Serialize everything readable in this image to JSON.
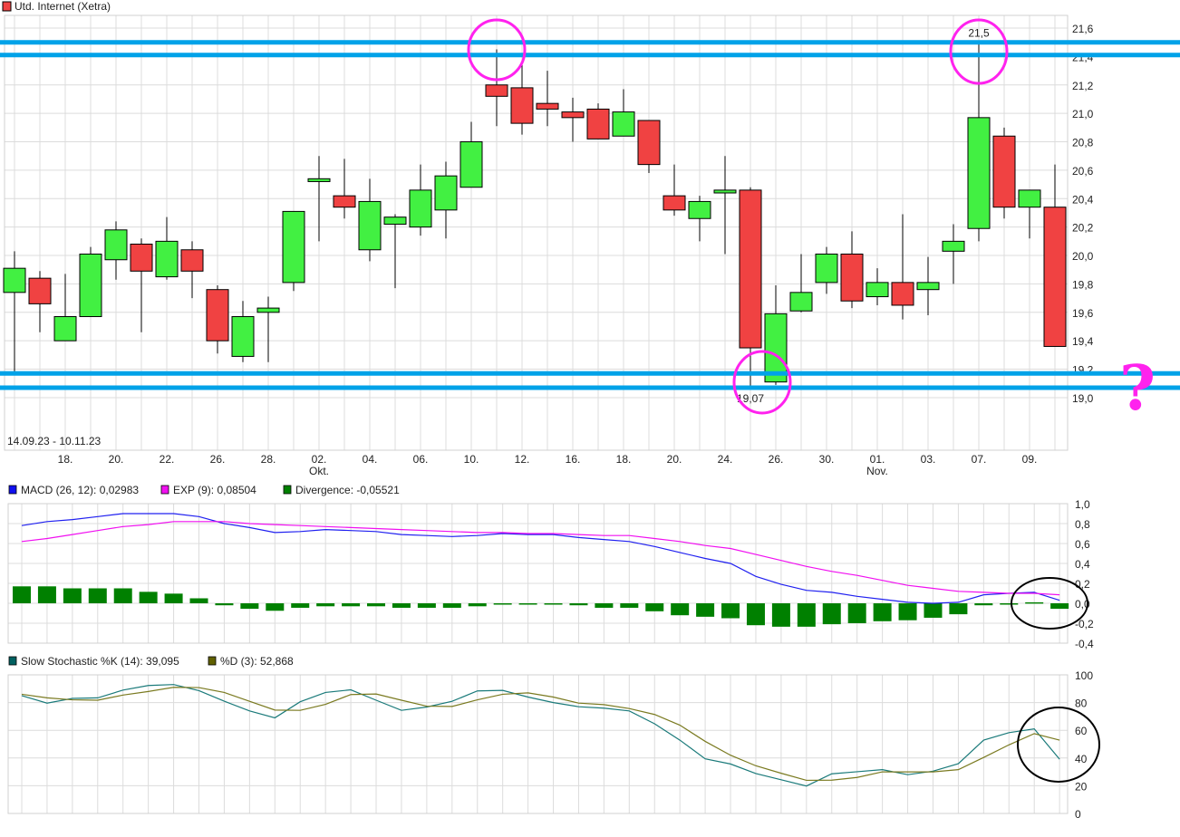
{
  "chart_data": [
    {
      "type": "candlestick",
      "title": "Utd. Internet (Xetra)",
      "date_range": "14.09.23 - 10.11.23",
      "legend_color": "#f04242",
      "up_color": "#42f042",
      "down_color": "#f04242",
      "ylim": [
        18.63,
        21.7
      ],
      "y_ticks": [
        "19,0",
        "19,2",
        "19,4",
        "19,6",
        "19,8",
        "20,0",
        "20,2",
        "20,4",
        "20,6",
        "20,8",
        "21,0",
        "21,2",
        "21,4",
        "21,6"
      ],
      "y_tick_values": [
        19.0,
        19.2,
        19.4,
        19.6,
        19.8,
        20.0,
        20.2,
        20.4,
        20.6,
        20.8,
        21.0,
        21.2,
        21.4,
        21.6
      ],
      "x_ticks": [
        {
          "date": "18.09",
          "label": "18."
        },
        {
          "date": "20.09",
          "label": "20."
        },
        {
          "date": "22.09",
          "label": "22."
        },
        {
          "date": "26.09",
          "label": "26."
        },
        {
          "date": "28.09",
          "label": "28."
        },
        {
          "date": "02.10",
          "label": "02.",
          "month": "Okt."
        },
        {
          "date": "04.10",
          "label": "04."
        },
        {
          "date": "06.10",
          "label": "06."
        },
        {
          "date": "10.10",
          "label": "10."
        },
        {
          "date": "12.10",
          "label": "12."
        },
        {
          "date": "16.10",
          "label": "16."
        },
        {
          "date": "18.10",
          "label": "18."
        },
        {
          "date": "20.10",
          "label": "20."
        },
        {
          "date": "24.10",
          "label": "24."
        },
        {
          "date": "26.10",
          "label": "26."
        },
        {
          "date": "30.10",
          "label": "30."
        },
        {
          "date": "01.11",
          "label": "01.",
          "month": "Nov."
        },
        {
          "date": "03.11",
          "label": "03."
        },
        {
          "date": "07.11",
          "label": "07."
        },
        {
          "date": "09.11",
          "label": "09."
        }
      ],
      "candles": [
        {
          "date": "14.09",
          "o": 19.74,
          "h": 20.03,
          "l": 19.18,
          "c": 19.91
        },
        {
          "date": "15.09",
          "o": 19.84,
          "h": 19.89,
          "l": 19.46,
          "c": 19.66
        },
        {
          "date": "18.09",
          "o": 19.4,
          "h": 19.87,
          "l": 19.4,
          "c": 19.57
        },
        {
          "date": "19.09",
          "o": 19.57,
          "h": 20.06,
          "l": 19.57,
          "c": 20.01
        },
        {
          "date": "20.09",
          "o": 19.97,
          "h": 20.24,
          "l": 19.83,
          "c": 20.18
        },
        {
          "date": "21.09",
          "o": 20.08,
          "h": 20.12,
          "l": 19.46,
          "c": 19.89
        },
        {
          "date": "22.09",
          "o": 19.85,
          "h": 20.27,
          "l": 19.83,
          "c": 20.1
        },
        {
          "date": "25.09",
          "o": 20.04,
          "h": 20.1,
          "l": 19.7,
          "c": 19.89
        },
        {
          "date": "26.09",
          "o": 19.76,
          "h": 19.79,
          "l": 19.31,
          "c": 19.4
        },
        {
          "date": "27.09",
          "o": 19.29,
          "h": 19.68,
          "l": 19.25,
          "c": 19.57
        },
        {
          "date": "28.09",
          "o": 19.6,
          "h": 19.71,
          "l": 19.25,
          "c": 19.63
        },
        {
          "date": "29.09",
          "o": 19.81,
          "h": 20.31,
          "l": 19.75,
          "c": 20.31
        },
        {
          "date": "02.10",
          "o": 20.52,
          "h": 20.7,
          "l": 20.1,
          "c": 20.54
        },
        {
          "date": "03.10",
          "o": 20.42,
          "h": 20.68,
          "l": 20.26,
          "c": 20.34
        },
        {
          "date": "04.10",
          "o": 20.04,
          "h": 20.54,
          "l": 19.96,
          "c": 20.38
        },
        {
          "date": "05.10",
          "o": 20.22,
          "h": 20.29,
          "l": 19.77,
          "c": 20.27
        },
        {
          "date": "06.10",
          "o": 20.2,
          "h": 20.64,
          "l": 20.14,
          "c": 20.46
        },
        {
          "date": "09.10",
          "o": 20.32,
          "h": 20.66,
          "l": 20.12,
          "c": 20.56
        },
        {
          "date": "10.10",
          "o": 20.48,
          "h": 20.94,
          "l": 20.48,
          "c": 20.8
        },
        {
          "date": "11.10",
          "o": 21.2,
          "h": 21.45,
          "l": 20.91,
          "c": 21.12
        },
        {
          "date": "12.10",
          "o": 21.18,
          "h": 21.37,
          "l": 20.85,
          "c": 20.93
        },
        {
          "date": "13.10",
          "o": 21.07,
          "h": 21.3,
          "l": 20.91,
          "c": 21.03
        },
        {
          "date": "16.10",
          "o": 21.01,
          "h": 21.11,
          "l": 20.8,
          "c": 20.97
        },
        {
          "date": "17.10",
          "o": 21.03,
          "h": 21.07,
          "l": 20.82,
          "c": 20.82
        },
        {
          "date": "18.10",
          "o": 20.84,
          "h": 21.17,
          "l": 20.84,
          "c": 21.01
        },
        {
          "date": "19.10",
          "o": 20.95,
          "h": 20.95,
          "l": 20.58,
          "c": 20.64
        },
        {
          "date": "20.10",
          "o": 20.42,
          "h": 20.64,
          "l": 20.28,
          "c": 20.32
        },
        {
          "date": "23.10",
          "o": 20.26,
          "h": 20.42,
          "l": 20.1,
          "c": 20.38
        },
        {
          "date": "24.10",
          "o": 20.44,
          "h": 20.7,
          "l": 20.01,
          "c": 20.46
        },
        {
          "date": "25.10",
          "o": 20.46,
          "h": 20.48,
          "l": 19.07,
          "c": 19.35
        },
        {
          "date": "26.10",
          "o": 19.11,
          "h": 19.79,
          "l": 19.09,
          "c": 19.59
        },
        {
          "date": "27.10",
          "o": 19.61,
          "h": 20.01,
          "l": 19.6,
          "c": 19.74
        },
        {
          "date": "30.10",
          "o": 19.81,
          "h": 20.06,
          "l": 19.73,
          "c": 20.01
        },
        {
          "date": "31.10",
          "o": 20.01,
          "h": 20.17,
          "l": 19.63,
          "c": 19.68
        },
        {
          "date": "01.11",
          "o": 19.71,
          "h": 19.91,
          "l": 19.65,
          "c": 19.81
        },
        {
          "date": "02.11",
          "o": 19.81,
          "h": 20.29,
          "l": 19.55,
          "c": 19.65
        },
        {
          "date": "03.11",
          "o": 19.76,
          "h": 19.99,
          "l": 19.58,
          "c": 19.81
        },
        {
          "date": "06.11",
          "o": 20.03,
          "h": 20.22,
          "l": 19.8,
          "c": 20.1
        },
        {
          "date": "07.11",
          "o": 20.19,
          "h": 21.5,
          "l": 20.1,
          "c": 20.97
        },
        {
          "date": "08.11",
          "o": 20.84,
          "h": 20.9,
          "l": 20.26,
          "c": 20.34
        },
        {
          "date": "09.11",
          "o": 20.34,
          "h": 20.46,
          "l": 20.12,
          "c": 20.46
        },
        {
          "date": "10.11",
          "o": 20.34,
          "h": 20.64,
          "l": 19.36,
          "c": 19.36
        }
      ],
      "value_labels": [
        {
          "date": "07.11",
          "text": "21,5",
          "value": 21.5,
          "position": "above"
        },
        {
          "date": "25.10",
          "text": "19,07",
          "value": 19.07,
          "position": "below"
        }
      ],
      "annotations": {
        "line_color": "#00a2e8",
        "horizontal_lines": [
          21.5,
          21.41,
          19.17,
          19.07
        ],
        "highlight_color": "#ff22ee",
        "highlight_circles_at": [
          "11.10",
          "07.11",
          "25.10"
        ],
        "question_mark": "?"
      }
    },
    {
      "type": "line+bar",
      "legend": [
        {
          "text": "MACD (26, 12): 0,02983",
          "color": "#1010f0"
        },
        {
          "text": "EXP (9): 0,08504",
          "color": "#f010f0"
        },
        {
          "text": "Divergence: -0,05521",
          "color": "#008000"
        }
      ],
      "ylim": [
        -0.4,
        1.0
      ],
      "y_ticks": [
        "1,0",
        "0,8",
        "0,6",
        "0,4",
        "0,2",
        "0,0",
        "-0,2",
        "-0,4"
      ],
      "y_tick_values": [
        1.0,
        0.8,
        0.6,
        0.4,
        0.2,
        0.0,
        -0.2,
        -0.4
      ],
      "series": [
        {
          "name": "MACD (26, 12)",
          "type": "line",
          "color": "#2020f0",
          "values": [
            0.78,
            0.82,
            0.84,
            0.87,
            0.9,
            0.9,
            0.9,
            0.87,
            0.8,
            0.76,
            0.71,
            0.72,
            0.74,
            0.73,
            0.72,
            0.69,
            0.68,
            0.67,
            0.68,
            0.7,
            0.69,
            0.69,
            0.66,
            0.64,
            0.62,
            0.57,
            0.51,
            0.45,
            0.4,
            0.27,
            0.19,
            0.13,
            0.11,
            0.07,
            0.04,
            0.01,
            0.0,
            0.01,
            0.085,
            0.1,
            0.11,
            0.03
          ]
        },
        {
          "name": "EXP (9)",
          "type": "line",
          "color": "#f010f0",
          "values": [
            0.62,
            0.65,
            0.69,
            0.73,
            0.77,
            0.79,
            0.82,
            0.82,
            0.82,
            0.8,
            0.79,
            0.78,
            0.77,
            0.76,
            0.75,
            0.74,
            0.73,
            0.72,
            0.71,
            0.71,
            0.7,
            0.7,
            0.69,
            0.68,
            0.68,
            0.65,
            0.62,
            0.58,
            0.55,
            0.49,
            0.43,
            0.37,
            0.32,
            0.28,
            0.23,
            0.18,
            0.15,
            0.12,
            0.11,
            0.1,
            0.1,
            0.085
          ]
        },
        {
          "name": "Divergence",
          "type": "bar",
          "color": "#008000",
          "values": [
            0.17,
            0.17,
            0.15,
            0.15,
            0.15,
            0.115,
            0.097,
            0.05,
            -0.02,
            -0.055,
            -0.075,
            -0.045,
            -0.03,
            -0.03,
            -0.03,
            -0.045,
            -0.045,
            -0.045,
            -0.03,
            -0.01,
            -0.01,
            -0.01,
            -0.02,
            -0.045,
            -0.045,
            -0.08,
            -0.12,
            -0.135,
            -0.15,
            -0.22,
            -0.235,
            -0.235,
            -0.21,
            -0.2,
            -0.18,
            -0.17,
            -0.145,
            -0.11,
            -0.02,
            -0.01,
            0.01,
            -0.055
          ]
        }
      ],
      "annotation_color": "#000000"
    },
    {
      "type": "line",
      "legend": [
        {
          "text": "Slow Stochastic %K (14): 39,095",
          "color": "#006060"
        },
        {
          "text": "%D (3): 52,868",
          "color": "#606000"
        }
      ],
      "ylim": [
        0,
        100
      ],
      "y_ticks": [
        "100",
        "80",
        "60",
        "40",
        "20",
        "0"
      ],
      "y_tick_values": [
        100,
        80,
        60,
        40,
        20,
        0
      ],
      "series": [
        {
          "name": "Slow Stochastic %K (14)",
          "color": "#1a7a7a",
          "values": [
            85,
            79.6,
            83,
            83.4,
            89,
            92.3,
            93,
            88.6,
            81,
            74,
            69,
            80.6,
            87.3,
            89.2,
            81.7,
            74.4,
            76.8,
            80.9,
            88.4,
            88.8,
            84,
            80,
            77,
            76,
            74,
            64.7,
            52.9,
            39.4,
            35.7,
            28.8,
            24.3,
            19.8,
            28.6,
            30.1,
            31.6,
            28,
            30.5,
            35.9,
            52.9,
            58.3,
            61,
            39.1
          ]
        },
        {
          "name": "%D (3)",
          "color": "#7a7a20",
          "values": [
            86,
            83.4,
            82,
            81.7,
            85.4,
            88,
            91,
            90.8,
            87.3,
            80.9,
            74.6,
            74.4,
            78.7,
            85.8,
            86.2,
            81.7,
            77.4,
            77.2,
            82,
            86,
            87,
            84,
            79.6,
            78.5,
            75.7,
            71.4,
            63.7,
            52,
            42,
            34.4,
            29,
            23.9,
            24,
            26,
            30,
            30,
            30,
            31.6,
            40.4,
            49.5,
            57.6,
            52.9
          ]
        }
      ],
      "annotation_color": "#000000"
    }
  ]
}
